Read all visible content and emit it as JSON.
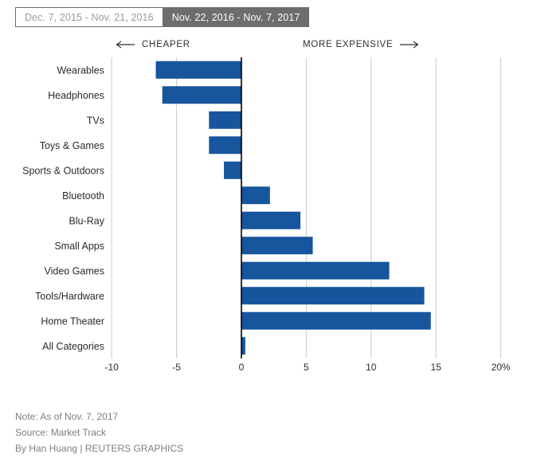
{
  "toggle": {
    "options": [
      {
        "label": "Dec. 7, 2015 - Nov. 21, 2016",
        "active": false
      },
      {
        "label": "Nov. 22, 2016 - Nov. 7, 2017",
        "active": true
      }
    ]
  },
  "direction": {
    "cheaper": "CHEAPER",
    "more_expensive": "MORE EXPENSIVE",
    "left_arrow_icon": "arrow-left-icon",
    "right_arrow_icon": "arrow-right-icon"
  },
  "footer": {
    "note": "Note: As of Nov. 7, 2017",
    "source": "Source: Market Track",
    "credit": "By Han Huang | REUTERS GRAPHICS"
  },
  "colors": {
    "bar": "#17559D",
    "zero_axis": "#000000",
    "gridline": "#c9c9c9",
    "toggle_active_bg": "#6d6d6d",
    "toggle_inactive_text": "#9a9a9a",
    "footer_text": "#7a7f85"
  },
  "chart_data": {
    "type": "bar",
    "orientation": "horizontal",
    "title": "",
    "subtitle": "",
    "xlabel": "",
    "ylabel": "",
    "xlim": [
      -10,
      20
    ],
    "x_ticks": [
      -10,
      -5,
      0,
      5,
      10,
      15,
      20
    ],
    "x_tick_labels": [
      "-10",
      "-5",
      "0",
      "5",
      "10",
      "15",
      "20%"
    ],
    "grid": true,
    "legend": false,
    "categories": [
      "Wearables",
      "Headphones",
      "TVs",
      "Toys & Games",
      "Sports & Outdoors",
      "Bluetooth",
      "Blu-Ray",
      "Small Apps",
      "Video Games",
      "Tools/Hardware",
      "Home Theater",
      "All Categories"
    ],
    "values": [
      -6.6,
      -6.1,
      -2.5,
      -2.5,
      -1.35,
      2.2,
      4.55,
      5.5,
      11.4,
      14.1,
      14.6,
      0.3
    ],
    "annotations": [
      "CHEAPER",
      "MORE EXPENSIVE"
    ]
  }
}
